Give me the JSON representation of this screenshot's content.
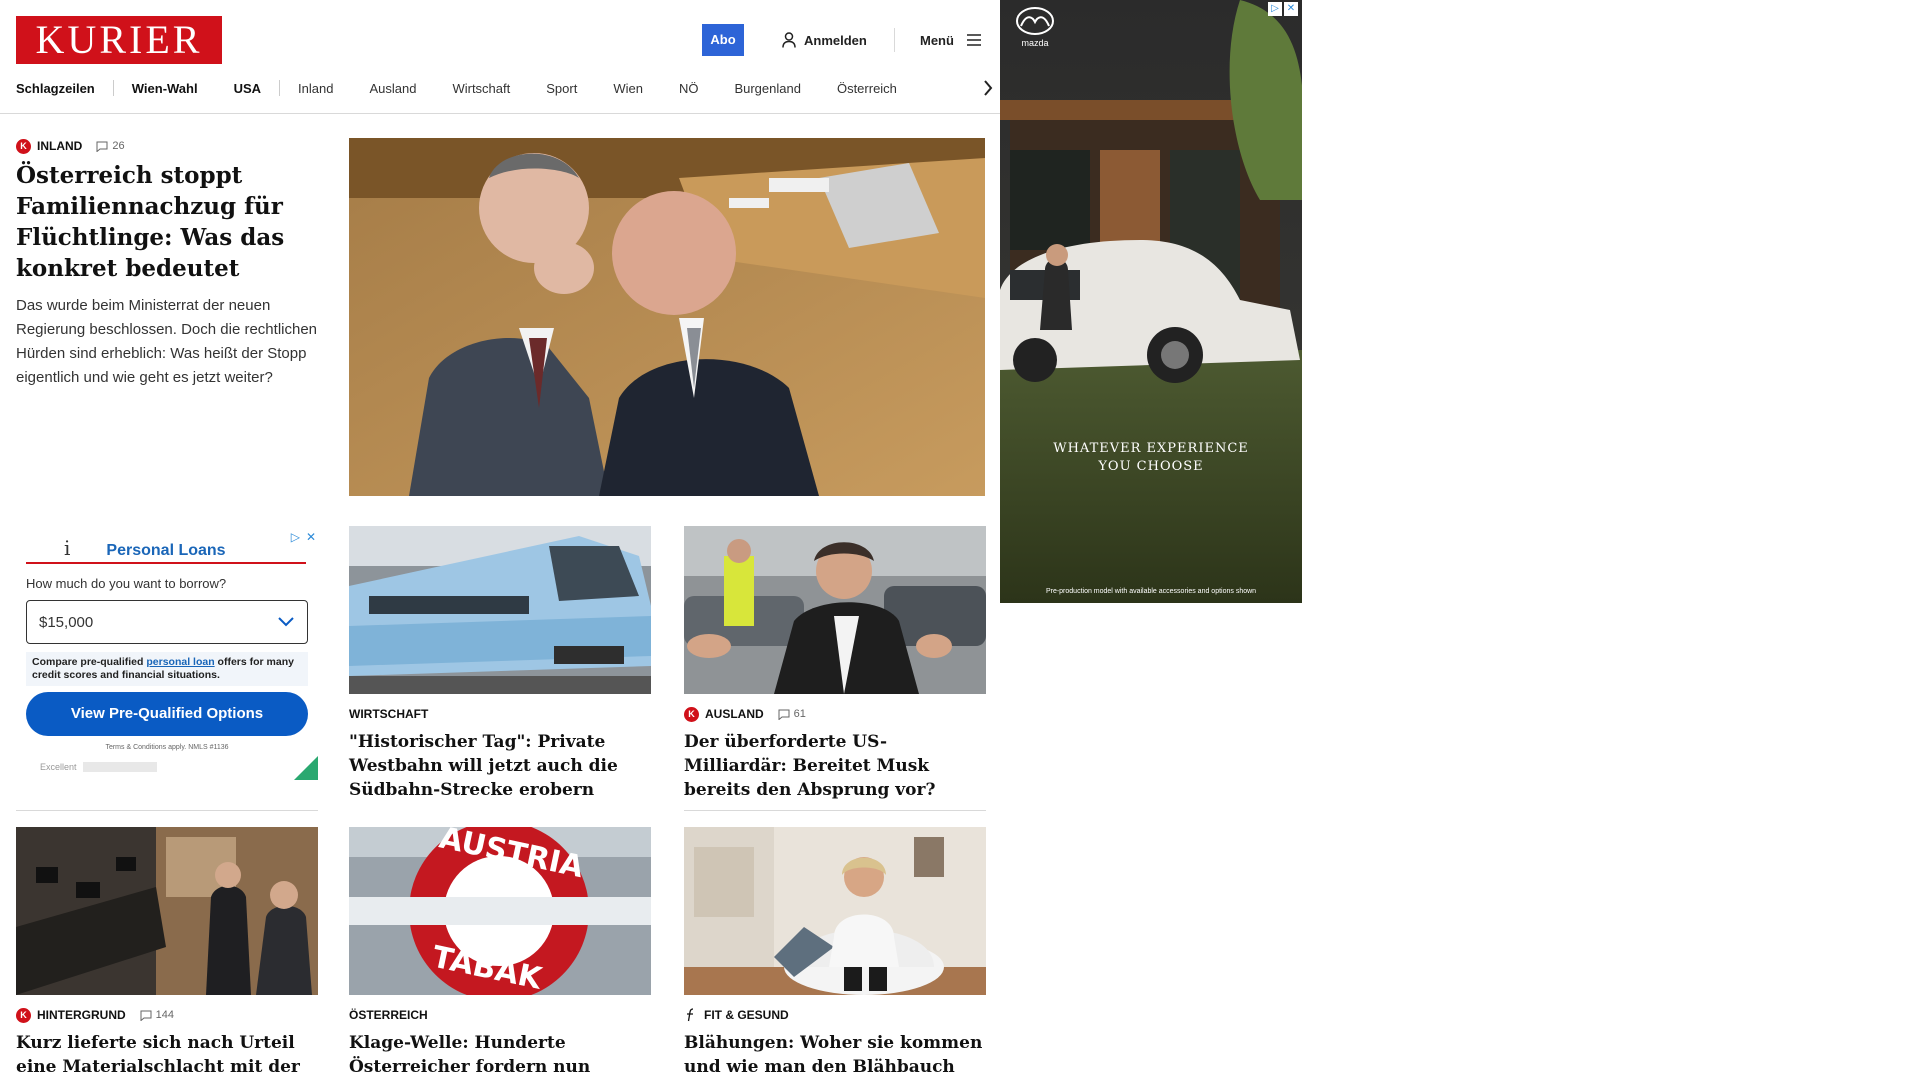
{
  "header": {
    "logo": "KURIER",
    "abo": "Abo",
    "login": "Anmelden",
    "menu": "Menü"
  },
  "nav": {
    "items": [
      "Schlagzeilen",
      "Wien-Wahl",
      "USA",
      "Inland",
      "Ausland",
      "Wirtschaft",
      "Sport",
      "Wien",
      "NÖ",
      "Burgenland",
      "Österreich"
    ]
  },
  "lead": {
    "category": "INLAND",
    "badge": "K",
    "comments": "26",
    "title": "Österreich stoppt Familiennachzug für Flüchtlinge: Was das konkret bedeutet",
    "teaser": "Das wurde beim Ministerrat der neuen Regierung beschlossen. Doch die rechtlichen Hürden sind erheblich: Was heißt der Stopp eigentlich und wie geht es jetzt weiter?"
  },
  "loan_ad": {
    "brand_letter": "i",
    "title": "Personal Loans",
    "question": "How much do you want to borrow?",
    "amount": "$15,000",
    "note_before": "Compare pre-qualified ",
    "note_link": "personal loan",
    "note_after": " offers for many credit scores and financial situations.",
    "button": "View Pre-Qualified Options",
    "terms": "Terms & Conditions apply. NMLS #1136",
    "rating": "Excellent"
  },
  "cards": [
    {
      "category": "WIRTSCHAFT",
      "comments": "",
      "title": "\"Historischer Tag\": Private Westbahn will jetzt auch die Südbahn-Strecke erobern"
    },
    {
      "category": "AUSLAND",
      "badge": "K",
      "comments": "61",
      "title": "Der überforderte US-Milliardär: Bereitet Musk bereits den Absprung vor?"
    },
    {
      "category": "HINTERGRUND",
      "badge": "K",
      "comments": "144",
      "title": "Kurz lieferte sich nach Urteil eine Materialschlacht mit der Justiz"
    },
    {
      "category": "ÖSTERREICH",
      "comments": "",
      "title": "Klage-Welle: Hunderte Österreicher fordern nun Lotto-Jackpot"
    },
    {
      "category": "FIT & GESUND",
      "comments": "",
      "title": "Blähungen: Woher sie kommen und wie man den Blähbauch los wird"
    }
  ],
  "mazda_ad": {
    "brand": "mazda",
    "tagline_1": "WHATEVER EXPERIENCE",
    "tagline_2": "YOU CHOOSE",
    "disclaimer": "Pre-production model with available accessories and options shown"
  },
  "tobacco_sign": {
    "top": "AUSTRIA",
    "bottom": "TABAK"
  },
  "colors": {
    "brand_red": "#d0111a",
    "abo_blue": "#2d64d7",
    "loan_blue": "#0a5bc4"
  }
}
